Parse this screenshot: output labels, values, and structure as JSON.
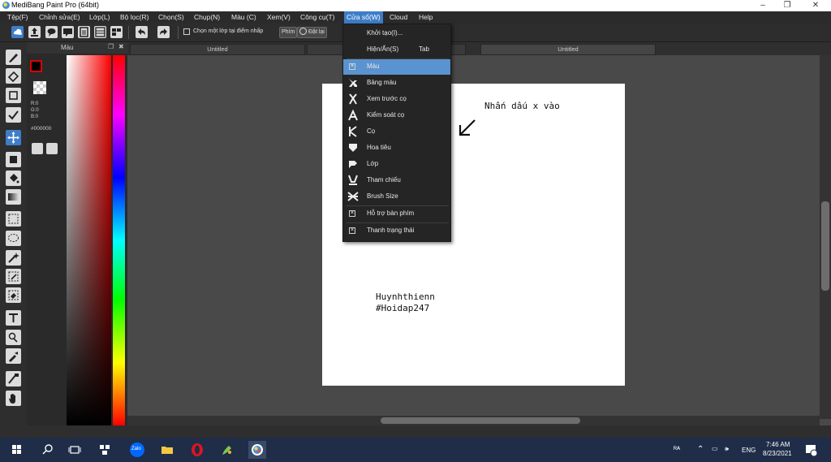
{
  "window": {
    "title": "MediBang Paint Pro (64bit)",
    "controls": [
      "–",
      "❐",
      "✕"
    ]
  },
  "menubar": [
    "Tệp(F)",
    "Chỉnh sửa(E)",
    "Lớp(L)",
    "Bộ lọc(R)",
    "Chọn(S)",
    "Chụp(N)",
    "Màu (C)",
    "Xem(V)",
    "Công cụ(T)",
    "Cửa sổ(W)",
    "Cloud",
    "Help"
  ],
  "toolbar": {
    "select_layer_checkbox_label": "Chọn một lớp tại điểm nhấp",
    "key_label": "Phím",
    "reset_label": "Đặt lại"
  },
  "color_panel": {
    "title": "Màu",
    "r": "R:0",
    "g": "G:0",
    "b": "B:0",
    "hex": "#000000",
    "fg_color": "#000000",
    "bg_color": "#d84cd8"
  },
  "tabs": [
    "Untitled",
    "Untitled"
  ],
  "canvas": {
    "note": "Nhấn dấu x vào",
    "author_line1": "Huynhthienn",
    "author_line2": "#Hoidap247"
  },
  "dropdown": {
    "items": [
      {
        "label": "Khởi tạo(I)...",
        "shortcut": "",
        "icon": ""
      },
      {
        "label": "Hiện/Ẩn(S)",
        "shortcut": "Tab",
        "icon": ""
      },
      {
        "label": "Màu",
        "shortcut": "",
        "icon": "checkbox-checked"
      },
      {
        "label": "Bảng màu",
        "shortcut": "",
        "icon": "palette-icon"
      },
      {
        "label": "Xem trước cọ",
        "shortcut": "",
        "icon": "brush-preview-icon"
      },
      {
        "label": "Kiểm soát cọ",
        "shortcut": "",
        "icon": "brush-control-icon"
      },
      {
        "label": "Cọ",
        "shortcut": "",
        "icon": "brush-icon"
      },
      {
        "label": "Hoa tiêu",
        "shortcut": "",
        "icon": "navigator-icon"
      },
      {
        "label": "Lớp",
        "shortcut": "",
        "icon": "layer-icon"
      },
      {
        "label": "Tham chiếu",
        "shortcut": "",
        "icon": "reference-icon"
      },
      {
        "label": "Brush Size",
        "shortcut": "",
        "icon": "brush-size-icon"
      },
      {
        "label": "Hỗ trợ bàn phím",
        "shortcut": "",
        "icon": "checkbox-checked"
      },
      {
        "label": "Thanh trạng thái",
        "shortcut": "",
        "icon": "checkbox-checked"
      }
    ],
    "checkbox_mark": "×"
  },
  "taskbar": {
    "tray_lang": "ENG",
    "time": "7:46 AM",
    "date": "8/23/2021",
    "zalo_label": "Zalo"
  }
}
